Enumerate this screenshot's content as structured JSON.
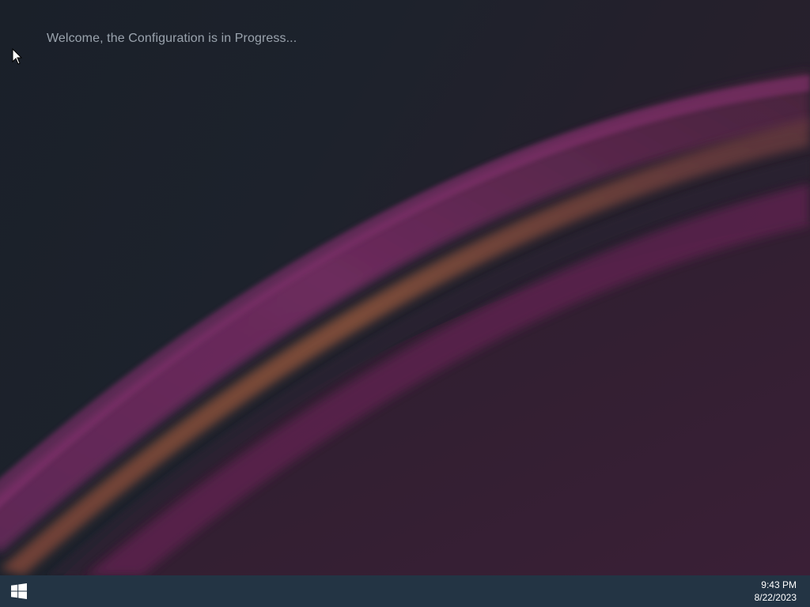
{
  "desktop": {
    "welcome_message": "Welcome, the Configuration is in Progress..."
  },
  "taskbar": {
    "start_icon": "windows-logo-icon",
    "clock": {
      "time": "9:43 PM",
      "date": "8/22/2023"
    }
  },
  "colors": {
    "taskbar": "#233444",
    "background_dark": "#1d222c",
    "accent_magenta": "#7a2d64",
    "accent_orange": "#9a5a3a",
    "welcome_text": "#9aa3ad"
  }
}
